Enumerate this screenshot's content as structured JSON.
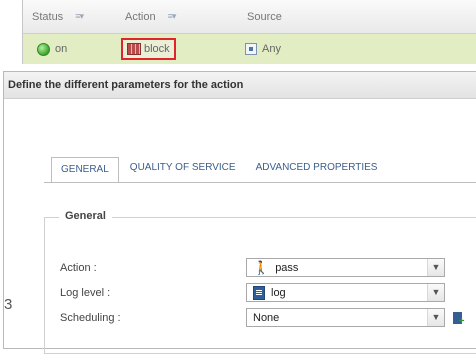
{
  "grid": {
    "columns": [
      {
        "label": "Status",
        "sort_icon": "sort-filter-icon"
      },
      {
        "label": "Action",
        "sort_icon": "sort-filter-icon"
      },
      {
        "label": "Source"
      }
    ],
    "row": {
      "status": "on",
      "action": "block",
      "source": "Any"
    },
    "highlight_color": "#e0242b",
    "row_color": "#e3edc3"
  },
  "dialog": {
    "title": "Define the different parameters for the action",
    "tabs": [
      {
        "label": "GENERAL",
        "active": true
      },
      {
        "label": "QUALITY OF SERVICE",
        "active": false
      },
      {
        "label": "ADVANCED PROPERTIES",
        "active": false
      }
    ],
    "section_title": "General",
    "side_mark": "3",
    "fields": {
      "action": {
        "label": "Action :",
        "value": "pass",
        "icon": "pass-icon"
      },
      "log_level": {
        "label": "Log level :",
        "value": "log",
        "icon": "log-icon"
      },
      "scheduling": {
        "label": "Scheduling :",
        "value": "None",
        "icon": "add-schedule-icon"
      }
    }
  }
}
